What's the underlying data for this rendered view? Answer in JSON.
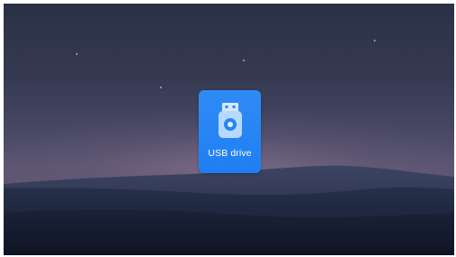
{
  "desktop": {
    "wallpaper": "night-desert-dunes",
    "icons": [
      {
        "label": "USB drive",
        "icon": "usb-drive-icon",
        "selected": true,
        "accent": "#2386f4"
      }
    ]
  }
}
